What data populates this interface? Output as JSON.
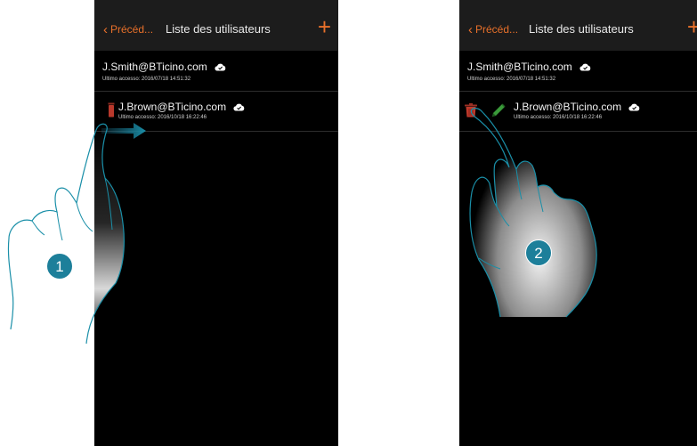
{
  "screen1": {
    "back_label": "Précéd...",
    "title": "Liste des utilisateurs",
    "add_label": "+",
    "users": [
      {
        "email": "J.Smith@BTicino.com",
        "last_access": "Ultimo accesso: 2016/07/18 14:51:32"
      },
      {
        "email": "J.Brown@BTicino.com",
        "last_access": "Ultimo accesso: 2016/10/18 16:22:46"
      }
    ],
    "step": "1"
  },
  "screen2": {
    "back_label": "Précéd...",
    "title": "Liste des utilisateurs",
    "add_label": "+",
    "users": [
      {
        "email": "J.Smith@BTicino.com",
        "last_access": "Ultimo accesso: 2016/07/18 14:51:32"
      },
      {
        "email": "J.Brown@BTicino.com",
        "last_access": "Ultimo accesso: 2016/10/18 16:22:46"
      }
    ],
    "step": "2"
  },
  "icons": {
    "cloud": "cloud-check-icon",
    "trash": "trash-icon",
    "edit": "pencil-icon",
    "back": "chevron-left-icon",
    "add": "plus-icon",
    "swipe": "arrow-right-icon"
  },
  "colors": {
    "accent": "#e8702a",
    "delete": "#c0392b",
    "edit": "#3a9a3a",
    "badge": "#1d7f9a",
    "hand_outline": "#1a8fa8",
    "arrow": "#1a6f8a"
  }
}
